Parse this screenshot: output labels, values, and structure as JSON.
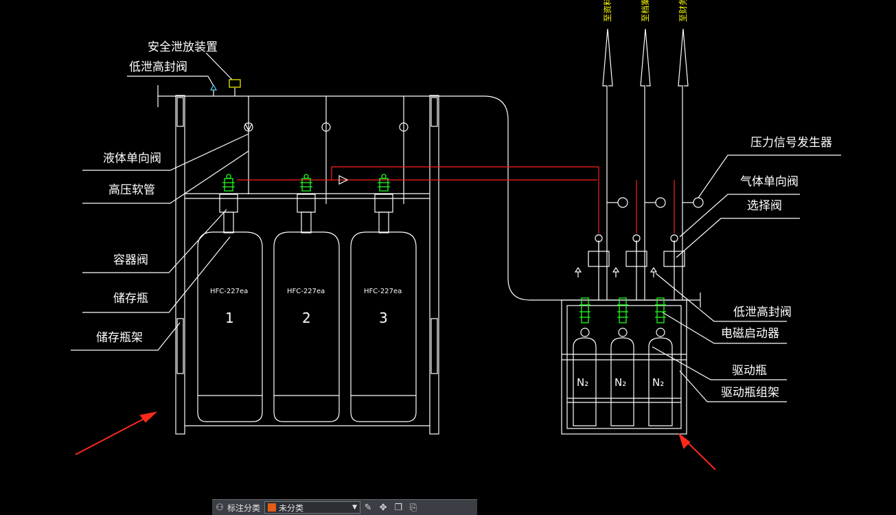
{
  "labels": {
    "safety_relief": "安全泄放装置",
    "low_leak_seal_valve_top": "低泄高封阀",
    "liquid_check_valve": "液体单向阀",
    "hp_hose": "高压软管",
    "container_valve": "容器阀",
    "storage_cylinder": "储存瓶",
    "cylinder_rack": "储存瓶架",
    "pressure_signal": "压力信号发生器",
    "gas_check_valve": "气体单向阀",
    "selector_valve": "选择阀",
    "low_leak_seal_valve_right": "低泄高封阀",
    "solenoid_actuator": "电磁启动器",
    "driver_cylinder": "驱动瓶",
    "driver_rack": "驱动瓶组架"
  },
  "outlets": [
    "至资料室",
    "至档案室",
    "至财务室"
  ],
  "cylinders": [
    {
      "agent": "HFC-227ea",
      "number": "1"
    },
    {
      "agent": "HFC-227ea",
      "number": "2"
    },
    {
      "agent": "HFC-227ea",
      "number": "3"
    }
  ],
  "drivers": [
    {
      "gas": "N₂"
    },
    {
      "gas": "N₂"
    },
    {
      "gas": "N₂"
    }
  ],
  "toolbar": {
    "category_label": "标注分类",
    "category_value": "未分类",
    "swatch_color": "#e25c1a"
  },
  "colors": {
    "line": "#ffffff",
    "pilot": "#ff2020",
    "valve": "#20ff20",
    "arrow": "#ff2a1a",
    "relief": "#ffff00"
  }
}
